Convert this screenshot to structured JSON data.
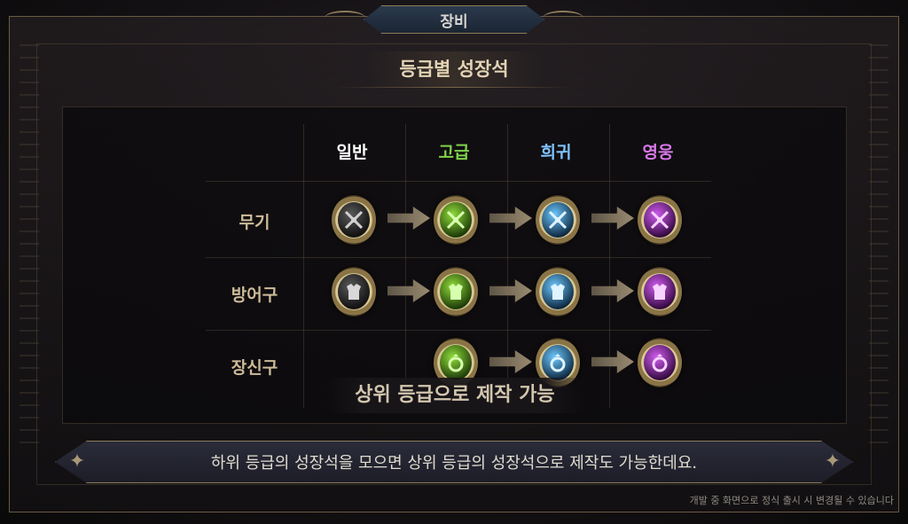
{
  "tab": {
    "label": "장비"
  },
  "section": {
    "title": "등급별 성장석"
  },
  "columns": [
    {
      "label": "일반",
      "color": "#ffffff"
    },
    {
      "label": "고급",
      "color": "#7fd24a"
    },
    {
      "label": "희귀",
      "color": "#7fc4ff"
    },
    {
      "label": "영웅",
      "color": "#d77ae8"
    }
  ],
  "rows": [
    {
      "label": "무기",
      "icon": "weapon-icon"
    },
    {
      "label": "방어구",
      "icon": "armor-icon"
    },
    {
      "label": "장신구",
      "icon": "ring-icon"
    }
  ],
  "overlay_note": "상위 등급으로 제작 가능",
  "banner_text": "하위 등급의 성장석을 모으면 상위 등급의 성장석으로 제작도 가능한데요.",
  "disclaimer": "개발 중 화면으로 정식 출시 시 변경될 수 있습니다"
}
